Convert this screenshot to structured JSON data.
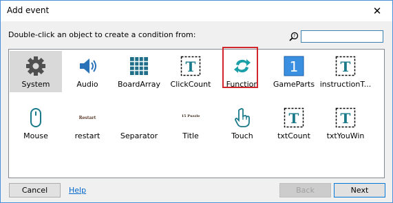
{
  "window": {
    "title": "Add event",
    "close_glyph": "✕"
  },
  "instruction": "Double-click an object to create a condition from:",
  "search": {
    "icon": "search-icon",
    "value": ""
  },
  "objects": [
    {
      "label": "System",
      "icon": "gear-icon",
      "selected": true
    },
    {
      "label": "Audio",
      "icon": "speaker-icon"
    },
    {
      "label": "BoardArray",
      "icon": "grid-icon"
    },
    {
      "label": "ClickCount",
      "icon": "text-object-icon"
    },
    {
      "label": "Function",
      "icon": "function-arrows-icon",
      "highlighted": true
    },
    {
      "label": "GameParts",
      "icon": "number-one-icon",
      "icon_text": "1"
    },
    {
      "label": "instructionT...",
      "icon": "text-object-icon"
    },
    {
      "label": "Mouse",
      "icon": "mouse-icon"
    },
    {
      "label": "restart",
      "icon": "sprite-restart-icon",
      "icon_text": "Restart"
    },
    {
      "label": "Separator",
      "icon": "blank-sprite-icon"
    },
    {
      "label": "Title",
      "icon": "sprite-title-icon",
      "icon_text": "15 Puzzle"
    },
    {
      "label": "Touch",
      "icon": "touch-hand-icon"
    },
    {
      "label": "txtCount",
      "icon": "text-object-icon"
    },
    {
      "label": "txtYouWin",
      "icon": "text-object-icon"
    }
  ],
  "buttons": {
    "cancel": "Cancel",
    "help": "Help",
    "back": "Back",
    "next": "Next"
  },
  "colors": {
    "accent": "#0078d7",
    "highlight": "#d0262b",
    "function_teal": "#1a9fa8",
    "gameparts_blue": "#3b8fe0"
  }
}
